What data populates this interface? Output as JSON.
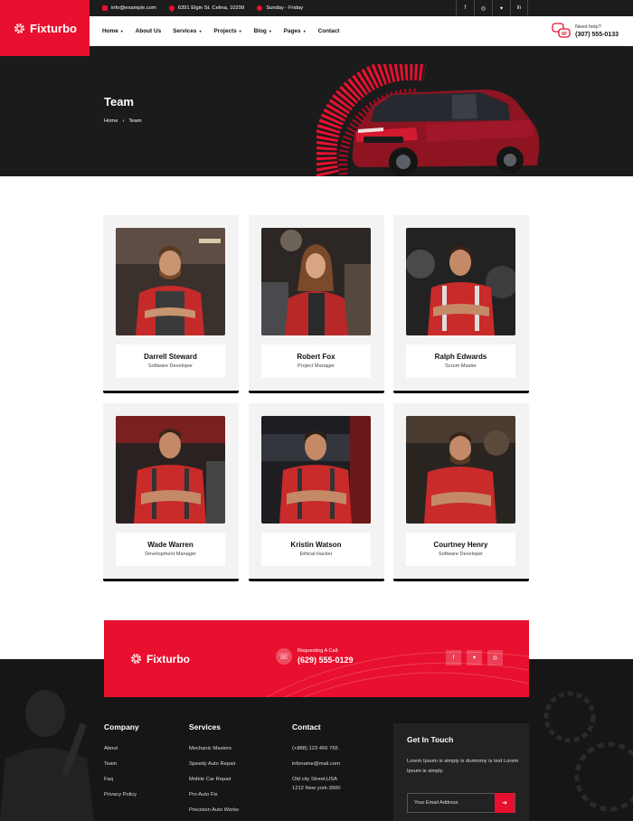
{
  "brand": {
    "name": "Fixturbo"
  },
  "topbar": {
    "email": "info@example.com",
    "address": "6391 Elgin St. Celina, 10299",
    "hours": "Sunday - Friday"
  },
  "nav": {
    "items": [
      {
        "label": "Home",
        "dropdown": true
      },
      {
        "label": "About Us",
        "dropdown": false
      },
      {
        "label": "Services",
        "dropdown": true
      },
      {
        "label": "Projects",
        "dropdown": true
      },
      {
        "label": "Blog",
        "dropdown": true
      },
      {
        "label": "Pages",
        "dropdown": true
      },
      {
        "label": "Contact",
        "dropdown": false
      }
    ],
    "help_label": "Need help?",
    "help_phone": "(307) 555-0133"
  },
  "hero": {
    "title": "Team",
    "breadcrumb": [
      "Home",
      "Team"
    ],
    "separator": "›"
  },
  "team": [
    {
      "name": "Darrell Steward",
      "role": "Software Developer"
    },
    {
      "name": "Robert Fox",
      "role": "Project Manager"
    },
    {
      "name": "Ralph Edwards",
      "role": "Scrum Master"
    },
    {
      "name": "Wade Warren",
      "role": "Development Manager"
    },
    {
      "name": "Kristin Watson",
      "role": "Ethical Hacker"
    },
    {
      "name": "Courtney Henry",
      "role": "Software Developer"
    }
  ],
  "cta": {
    "brand": "Fixturbo",
    "call_label": "Requesting A Call:",
    "call_number": "(629) 555-0129"
  },
  "footer": {
    "company": {
      "title": "Company",
      "links": [
        "About",
        "Team",
        "Faq",
        "Privacy Policy"
      ]
    },
    "services": {
      "title": "Services",
      "links": [
        "Mechanic Masters",
        "Speedy Auto Repair",
        "Mobile Car Repair",
        "Pro Auto Fix",
        "Precision Auto Works"
      ]
    },
    "contact": {
      "title": "Contact",
      "lines": [
        "(+888) 123 456 765",
        "infoname@mail.com",
        "Old city Street,USA",
        "1212 New york-3500"
      ]
    },
    "touch": {
      "title": "Get In Touch",
      "text": "Lorem Ipsum is simply is dumiomy is text Lorem Ipsum is simply",
      "placeholder": "Your Email Address"
    }
  },
  "colors": {
    "accent": "#e8102e",
    "dark": "#1b1b1b"
  },
  "icons": [
    "envelope-icon",
    "location-pin-icon",
    "clock-icon",
    "facebook-icon",
    "instagram-icon",
    "twitter-icon",
    "linkedin-icon",
    "chat-icon",
    "phone-icon",
    "arrow-right-icon",
    "gear-icon"
  ]
}
